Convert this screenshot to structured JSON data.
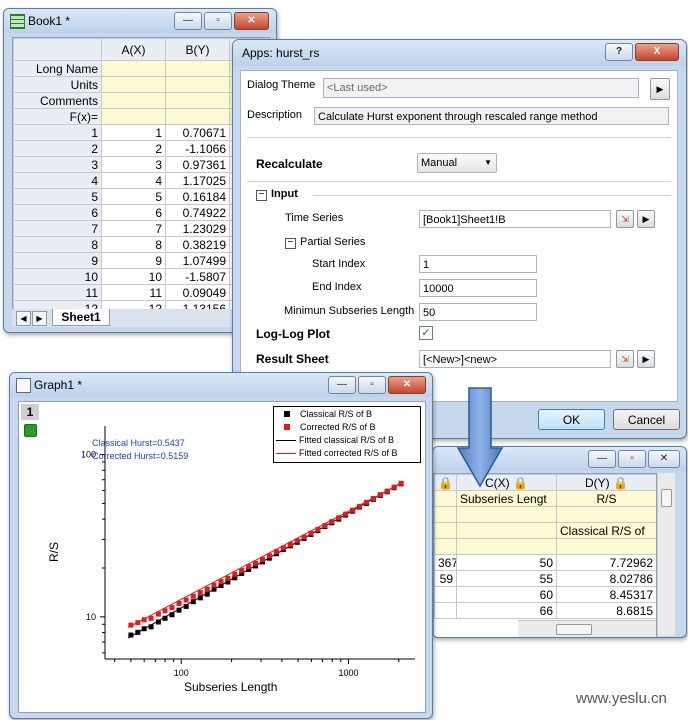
{
  "book1": {
    "title": "Book1 *",
    "col_a": "A(X)",
    "col_b": "B(Y)",
    "row_labels": [
      "Long Name",
      "Units",
      "Comments",
      "F(x)="
    ],
    "rows": [
      {
        "n": "1",
        "a": "1",
        "b": "0.70671"
      },
      {
        "n": "2",
        "a": "2",
        "b": "-1.1066"
      },
      {
        "n": "3",
        "a": "3",
        "b": "0.97361"
      },
      {
        "n": "4",
        "a": "4",
        "b": "1.17025"
      },
      {
        "n": "5",
        "a": "5",
        "b": "0.16184"
      },
      {
        "n": "6",
        "a": "6",
        "b": "0.74922"
      },
      {
        "n": "7",
        "a": "7",
        "b": "1.23029"
      },
      {
        "n": "8",
        "a": "8",
        "b": "0.38219"
      },
      {
        "n": "9",
        "a": "9",
        "b": "1.07499"
      },
      {
        "n": "10",
        "a": "10",
        "b": "-1.5807"
      },
      {
        "n": "11",
        "a": "11",
        "b": "0.09049"
      },
      {
        "n": "12",
        "a": "12",
        "b": "1.13156"
      }
    ],
    "sheet_tab": "Sheet1"
  },
  "dialog": {
    "title": "Apps: hurst_rs",
    "theme_label": "Dialog Theme",
    "theme_value": "<Last used>",
    "description_label": "Description",
    "description_value": "Calculate Hurst exponent through rescaled range method",
    "recalculate_label": "Recalculate",
    "recalculate_value": "Manual",
    "input_label": "Input",
    "time_series_label": "Time Series",
    "time_series_value": "[Book1]Sheet1!B",
    "partial_series_label": "Partial Series",
    "start_index_label": "Start Index",
    "start_index_value": "1",
    "end_index_label": "End Index",
    "end_index_value": "10000",
    "min_subseries_label": "Minimun Subseries Length",
    "min_subseries_value": "50",
    "loglog_label": "Log-Log Plot",
    "loglog_checked": true,
    "result_sheet_label": "Result Sheet",
    "result_sheet_value": "[<New>]<new>",
    "ok_label": "OK",
    "cancel_label": "Cancel",
    "help_glyph": "?",
    "close_glyph": "X"
  },
  "result_book": {
    "col_c": "C(X)",
    "col_d": "D(Y)",
    "c_longname": "Subseries Lengt",
    "d_longname": "R/S",
    "d_comments": "Classical R/S of",
    "partial_col_values": [
      "367",
      "59"
    ],
    "rows": [
      {
        "c": "50",
        "d": "7.72962"
      },
      {
        "c": "55",
        "d": "8.02786"
      },
      {
        "c": "60",
        "d": "8.45317"
      },
      {
        "c": "66",
        "d": "8.6815"
      }
    ]
  },
  "graph": {
    "title": "Graph1 *",
    "layer_number": "1",
    "annotation_line1": "Classical Hurst=0.5437",
    "annotation_line2": "Corrected Hurst=0.5159",
    "legend": [
      "Classical R/S of B",
      "Corrected R/S of B",
      "Fitted classical R/S of B",
      "Fitted corrected R/S of B"
    ],
    "colors": {
      "classical": "#000000",
      "corrected": "#e31a1c",
      "annotation": "#1f3fbf"
    }
  },
  "chart_data": {
    "type": "scatter",
    "xlabel": "Subseries Length",
    "ylabel": "R/S",
    "xscale": "log",
    "yscale": "log",
    "xlim": [
      35,
      2500
    ],
    "ylim": [
      5.5,
      150
    ],
    "x_ticks": [
      100,
      1000
    ],
    "x_tick_labels": [
      "100",
      "1000"
    ],
    "y_ticks": [
      10,
      100
    ],
    "y_tick_labels": [
      "10",
      "100"
    ],
    "legend_position": "top-right",
    "series": [
      {
        "name": "Classical R/S of B",
        "marker": "square",
        "color": "#000000",
        "x": [
          50,
          55,
          60,
          66,
          73,
          80,
          88,
          97,
          107,
          118,
          130,
          143,
          157,
          173,
          190,
          209,
          230,
          253,
          278,
          306,
          337,
          371,
          408,
          449,
          494,
          543,
          597,
          657,
          723,
          795,
          875,
          962,
          1059,
          1165,
          1281,
          1409,
          1550,
          1705,
          1876,
          2064
        ],
        "y": [
          7.73,
          8.03,
          8.45,
          8.68,
          9.3,
          9.8,
          10.3,
          11.0,
          11.6,
          12.4,
          13.1,
          13.8,
          14.8,
          15.6,
          16.4,
          17.4,
          18.5,
          19.6,
          20.6,
          21.8,
          23.0,
          24.5,
          26.0,
          27.4,
          28.8,
          30.4,
          32.2,
          34.0,
          36.0,
          38.0,
          40.0,
          42.4,
          44.8,
          47.5,
          50.0,
          53.0,
          56.0,
          59.0,
          62.5,
          66.0
        ]
      },
      {
        "name": "Corrected R/S of B",
        "marker": "square",
        "color": "#e31a1c",
        "x": [
          50,
          55,
          60,
          66,
          73,
          80,
          88,
          97,
          107,
          118,
          130,
          143,
          157,
          173,
          190,
          209,
          230,
          253,
          278,
          306,
          337,
          371,
          408,
          449,
          494,
          543,
          597,
          657,
          723,
          795,
          875,
          962,
          1059,
          1165,
          1281,
          1409,
          1550,
          1705,
          1876,
          2064
        ],
        "y": [
          8.9,
          9.2,
          9.6,
          9.8,
          10.4,
          10.9,
          11.4,
          12.1,
          12.7,
          13.4,
          14.1,
          14.8,
          15.7,
          16.5,
          17.3,
          18.3,
          19.3,
          20.4,
          21.4,
          22.6,
          23.8,
          25.2,
          26.6,
          28.0,
          29.4,
          31.0,
          32.8,
          34.6,
          36.5,
          38.6,
          40.8,
          43.0,
          45.4,
          48.0,
          50.8,
          53.6,
          56.6,
          59.6,
          63.0,
          66.5
        ]
      },
      {
        "name": "Fitted classical R/S of B",
        "line": true,
        "color": "#000000",
        "x": [
          48,
          2100
        ],
        "y": [
          7.4,
          67.5
        ]
      },
      {
        "name": "Fitted corrected R/S of B",
        "line": true,
        "color": "#e31a1c",
        "x": [
          48,
          2100
        ],
        "y": [
          8.6,
          67.0
        ]
      }
    ]
  }
}
